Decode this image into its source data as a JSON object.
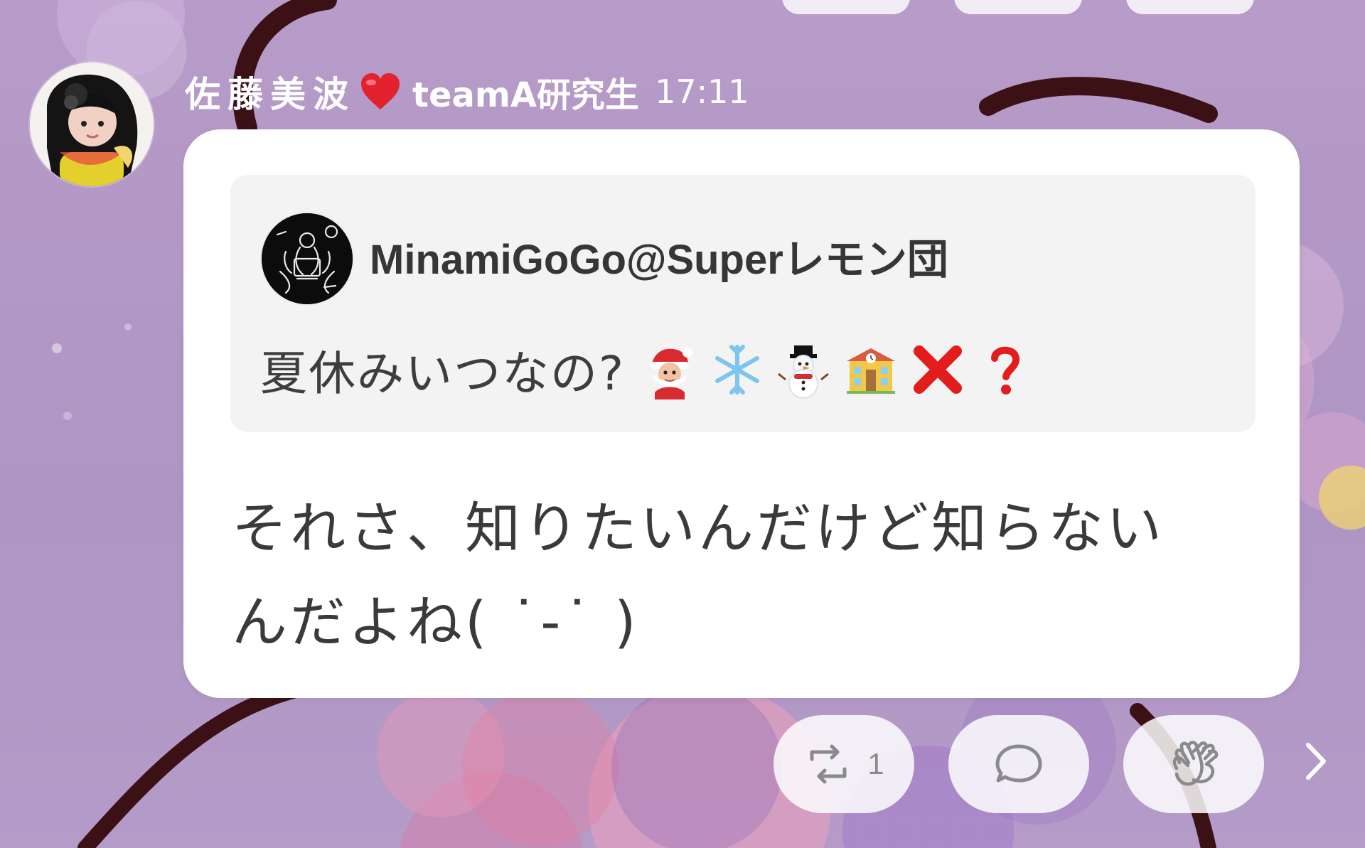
{
  "post": {
    "author_name": "佐藤美波",
    "heart_icon": "red-heart",
    "team_label": "teamA研究生",
    "time": "17:11",
    "quoted": {
      "username": "MinamiGoGo@Superレモン団",
      "text": "夏休みいつなの?",
      "emojis": [
        "santa-icon",
        "snowflake-icon",
        "snowman-icon",
        "school-icon",
        "cross-mark-icon",
        "question-mark-icon"
      ]
    },
    "message": "それさ、知りたいんだけど知らない\nんだよね( ˙-˙ )"
  },
  "actions": {
    "retweet_count": "1",
    "retweet_icon": "retweet-icon",
    "comment_icon": "comment-icon",
    "applause_icon": "applause-icon",
    "next_icon": "chevron-right-icon"
  },
  "colors": {
    "background": "#b69ac8",
    "bubble": "#ffffff",
    "quote_card": "#f3f3f3",
    "text": "#3a3a3a",
    "header_text": "#ffffff",
    "heart": "#e2232f",
    "icon_gray": "#8a8a8a"
  }
}
